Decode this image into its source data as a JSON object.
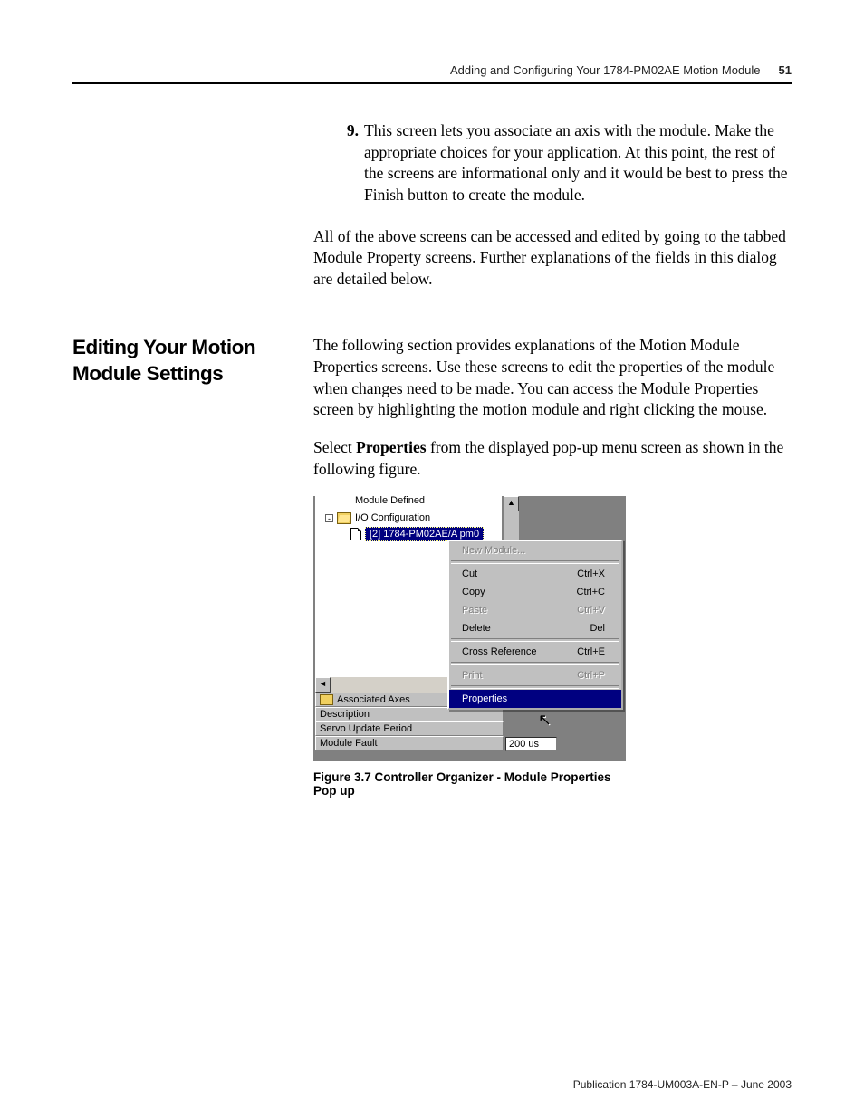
{
  "header": {
    "title": "Adding and Configuring Your 1784-PM02AE Motion Module",
    "page_number": "51"
  },
  "step9": {
    "number": "9.",
    "text": "This screen lets you associate an axis with the module. Make the appropriate choices for your application. At this point, the rest of the screens are informational only and it would be best to press the Finish button to create the module."
  },
  "para_after": "All of the above screens can be accessed and edited by going to the tabbed Module Property screens. Further explanations of the fields in this dialog are detailed below.",
  "section": {
    "heading": "Editing Your Motion Module Settings",
    "para1": "The following section provides explanations of the Motion Module Properties screens. Use these screens to edit the properties of the module when changes need to be made. You can access the Module Properties screen by highlighting the motion module and right clicking the mouse.",
    "para2_pre": "Select ",
    "para2_bold": "Properties",
    "para2_post": " from the displayed pop-up menu screen as shown in the following figure."
  },
  "screenshot": {
    "tree": {
      "clipped_top_label": "Module Defined",
      "expander": "-",
      "label_io_config": "I/O Configuration",
      "selected_module": "[2] 1784-PM02AE/A pm0"
    },
    "scroll": {
      "up": "▲",
      "down": "▼",
      "left": "◄",
      "right": "►"
    },
    "bottom_panel": {
      "row0": "Associated Axes",
      "row1": "Description",
      "row2": "Servo Update Period",
      "row3": "Module Fault",
      "value_row2": "200 us"
    },
    "context_menu": {
      "new_module": {
        "label": "New Module...",
        "shortcut": "",
        "disabled": true
      },
      "cut": {
        "label": "Cut",
        "shortcut": "Ctrl+X",
        "disabled": false
      },
      "copy": {
        "label": "Copy",
        "shortcut": "Ctrl+C",
        "disabled": false
      },
      "paste": {
        "label": "Paste",
        "shortcut": "Ctrl+V",
        "disabled": true
      },
      "delete": {
        "label": "Delete",
        "shortcut": "Del",
        "disabled": false
      },
      "cross_ref": {
        "label": "Cross Reference",
        "shortcut": "Ctrl+E",
        "disabled": false
      },
      "print": {
        "label": "Print",
        "shortcut": "Ctrl+P",
        "disabled": true
      },
      "properties": {
        "label": "Properties",
        "shortcut": "",
        "disabled": false,
        "selected": true
      }
    }
  },
  "figure_caption": "Figure 3.7 Controller Organizer - Module Properties Pop up",
  "footer": "Publication 1784-UM003A-EN-P – June 2003"
}
